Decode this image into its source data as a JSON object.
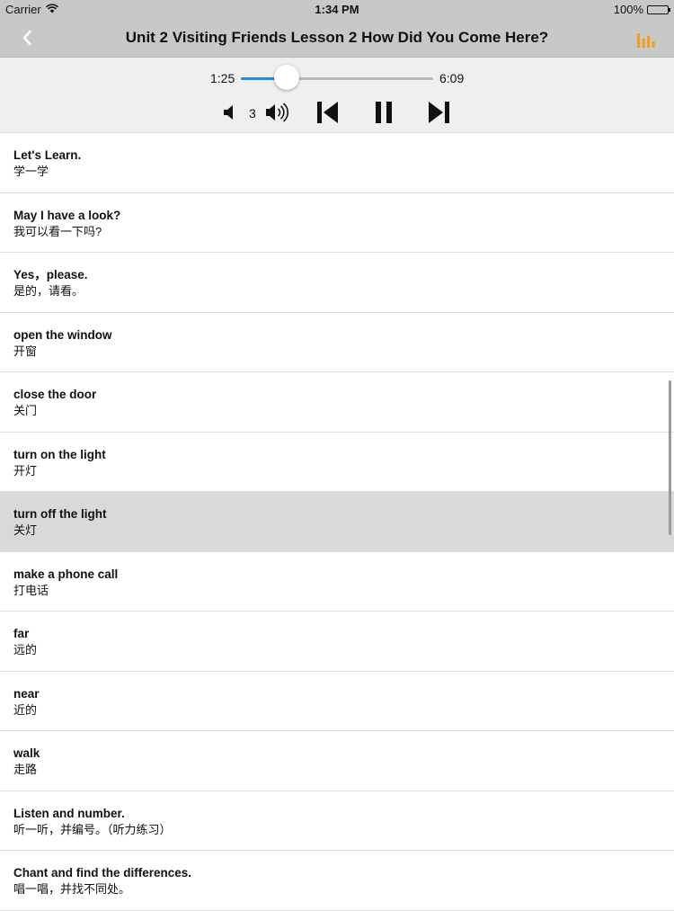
{
  "status_bar": {
    "carrier": "Carrier",
    "time": "1:34 PM",
    "battery": "100%"
  },
  "nav": {
    "title": "Unit 2 Visiting Friends Lesson 2 How Did You Come Here?",
    "back_icon": "chevron-left-icon",
    "right_icon": "equalizer-icon",
    "accent_color": "#f0a020"
  },
  "player": {
    "current_time": "1:25",
    "total_time": "6:09",
    "progress": 0.24,
    "volume": "3",
    "progress_color": "#1a8cf0"
  },
  "items": [
    {
      "en": "Let's Learn.",
      "zh": "学一学"
    },
    {
      "en": "May I have a look?",
      "zh": "我可以看一下吗?"
    },
    {
      "en": "Yes，please.",
      "zh": "是的，请看。"
    },
    {
      "en": "open the window",
      "zh": "开窗"
    },
    {
      "en": "close the door",
      "zh": "关门"
    },
    {
      "en": "turn on the light",
      "zh": "开灯"
    },
    {
      "en": "turn off the light",
      "zh": "关灯"
    },
    {
      "en": "make a phone call",
      "zh": "打电话"
    },
    {
      "en": "far",
      "zh": "远的"
    },
    {
      "en": "near",
      "zh": "近的"
    },
    {
      "en": "walk",
      "zh": "走路"
    },
    {
      "en": "Listen and number.",
      "zh": "听一听，并编号。（听力练习）"
    },
    {
      "en": "Chant and find the differences.",
      "zh": "唱一唱，并找不同处。"
    }
  ],
  "selected_index": 6
}
